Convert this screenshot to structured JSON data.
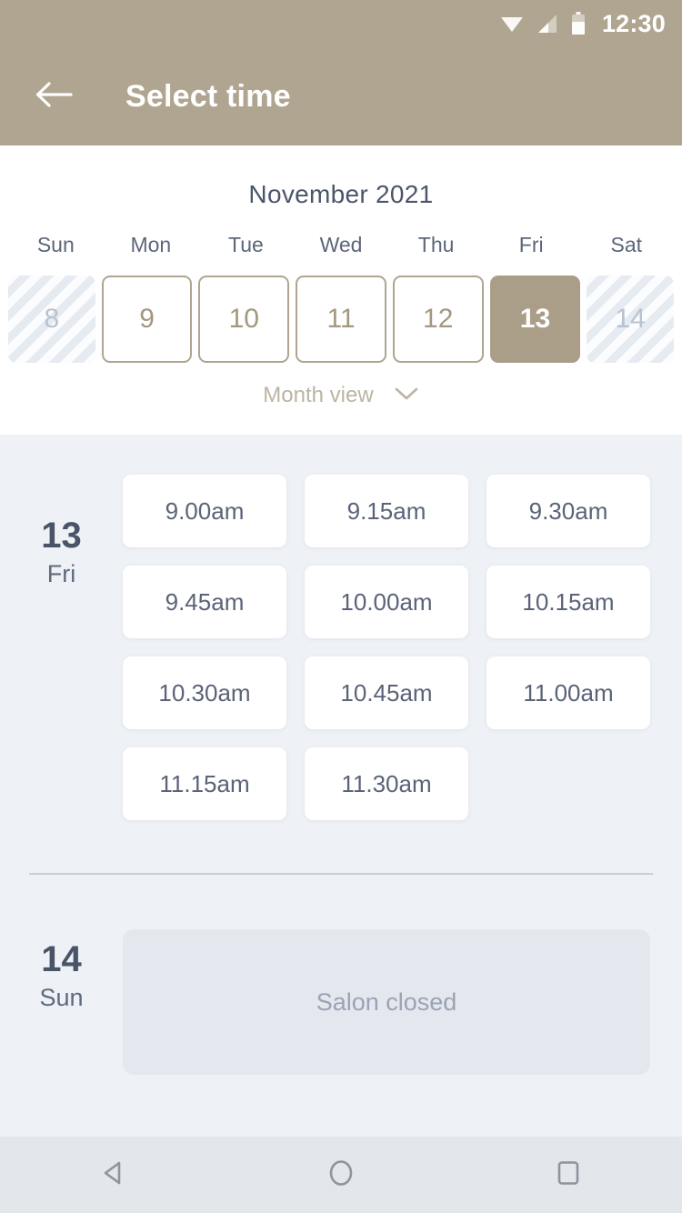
{
  "status_bar": {
    "time": "12:30",
    "icons": [
      "wifi-icon",
      "cellular-signal-icon",
      "battery-icon"
    ]
  },
  "app_bar": {
    "back_icon": "arrow-left-icon",
    "title": "Select time"
  },
  "calendar": {
    "month_title": "November 2021",
    "weekday_headers": [
      "Sun",
      "Mon",
      "Tue",
      "Wed",
      "Thu",
      "Fri",
      "Sat"
    ],
    "days": [
      {
        "number": "8",
        "state": "disabled"
      },
      {
        "number": "9",
        "state": "available"
      },
      {
        "number": "10",
        "state": "available"
      },
      {
        "number": "11",
        "state": "available"
      },
      {
        "number": "12",
        "state": "available"
      },
      {
        "number": "13",
        "state": "selected"
      },
      {
        "number": "14",
        "state": "disabled"
      }
    ],
    "month_view_toggle": {
      "label": "Month view",
      "icon": "chevron-down-icon"
    }
  },
  "schedule": [
    {
      "day_number": "13",
      "day_name": "Fri",
      "slots": [
        "9.00am",
        "9.15am",
        "9.30am",
        "9.45am",
        "10.00am",
        "10.15am",
        "10.30am",
        "10.45am",
        "11.00am",
        "11.15am",
        "11.30am"
      ]
    },
    {
      "day_number": "14",
      "day_name": "Sun",
      "closed_message": "Salon closed"
    }
  ],
  "nav_bar": {
    "back": "triangle-back-icon",
    "home": "circle-home-icon",
    "recents": "square-recents-icon"
  },
  "colors": {
    "brand_taupe": "#b0a590",
    "selected_day": "#ab9e89",
    "page_background": "#eef1f6",
    "slot_text": "#5a6377",
    "heading_text": "#4a5468",
    "closed_panel": "#e4e8ee"
  }
}
